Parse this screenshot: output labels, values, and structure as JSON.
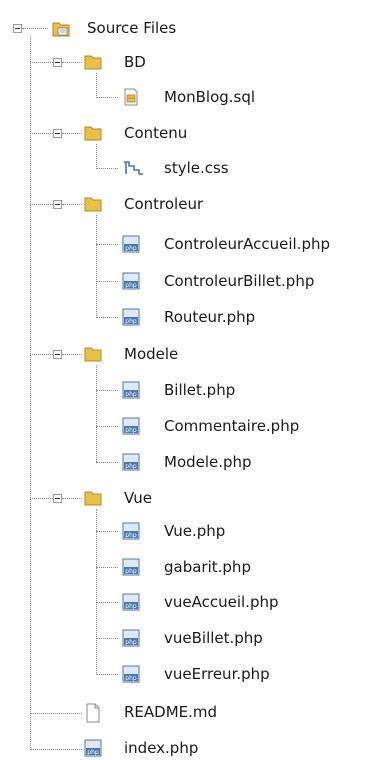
{
  "tree": {
    "root": {
      "label": "Source Files",
      "icon": "source-folder-icon"
    },
    "folders": [
      {
        "label": "BD",
        "icon": "folder-icon",
        "files": [
          {
            "label": "MonBlog.sql",
            "icon": "sql-file-icon"
          }
        ]
      },
      {
        "label": "Contenu",
        "icon": "folder-icon",
        "files": [
          {
            "label": "style.css",
            "icon": "css-file-icon"
          }
        ]
      },
      {
        "label": "Controleur",
        "icon": "folder-icon",
        "files": [
          {
            "label": "ControleurAccueil.php",
            "icon": "php-file-icon"
          },
          {
            "label": "ControleurBillet.php",
            "icon": "php-file-icon"
          },
          {
            "label": "Routeur.php",
            "icon": "php-file-icon"
          }
        ]
      },
      {
        "label": "Modele",
        "icon": "folder-icon",
        "files": [
          {
            "label": "Billet.php",
            "icon": "php-file-icon"
          },
          {
            "label": "Commentaire.php",
            "icon": "php-file-icon"
          },
          {
            "label": "Modele.php",
            "icon": "php-file-icon"
          }
        ]
      },
      {
        "label": "Vue",
        "icon": "folder-icon",
        "files": [
          {
            "label": "Vue.php",
            "icon": "php-file-icon"
          },
          {
            "label": "gabarit.php",
            "icon": "php-file-icon"
          },
          {
            "label": "vueAccueil.php",
            "icon": "php-file-icon"
          },
          {
            "label": "vueBillet.php",
            "icon": "php-file-icon"
          },
          {
            "label": "vueErreur.php",
            "icon": "php-file-icon"
          }
        ]
      }
    ],
    "root_files": [
      {
        "label": "README.md",
        "icon": "markdown-file-icon"
      },
      {
        "label": "index.php",
        "icon": "php-file-icon"
      }
    ],
    "colors": {
      "folder": "#e8c04a",
      "php_icon": "#4a78b0",
      "text": "#1a1a1a"
    }
  }
}
